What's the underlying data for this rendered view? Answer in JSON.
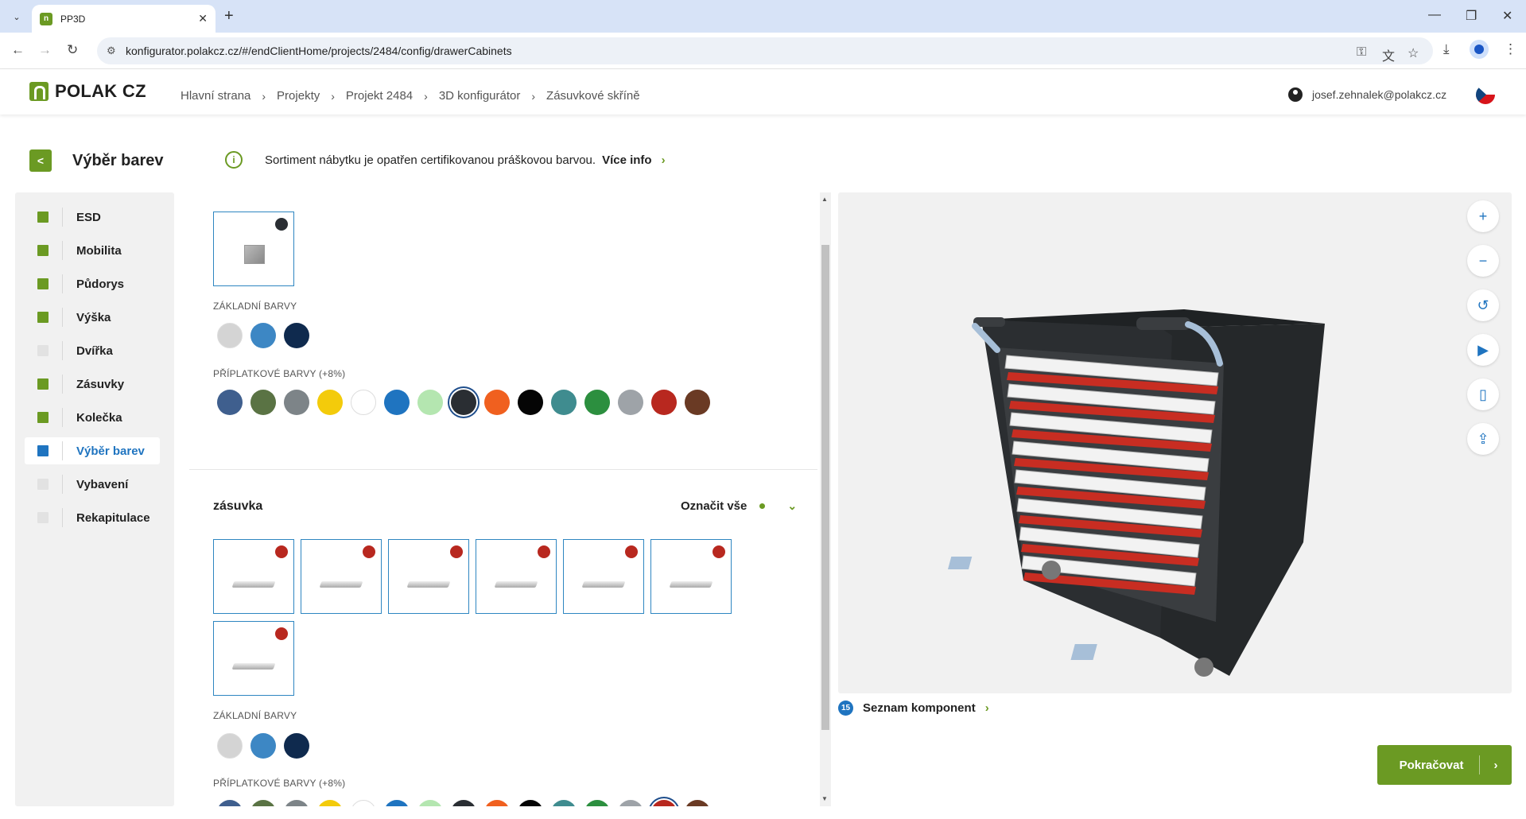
{
  "browser": {
    "tab_title": "PP3D",
    "url": "konfigurator.polakcz.cz/#/endClientHome/projects/2484/config/drawerCabinets"
  },
  "header": {
    "logo_text": "POLAK CZ",
    "breadcrumbs": [
      "Hlavní strana",
      "Projekty",
      "Projekt 2484",
      "3D konfigurátor",
      "Zásuvkové skříně"
    ],
    "user_email": "josef.zehnalek@polakcz.cz"
  },
  "page": {
    "title": "Výběr barev",
    "info_text": "Sortiment nábytku je opatřen certifikovanou práškovou barvou.",
    "info_link": "Více info"
  },
  "sidebar": {
    "items": [
      {
        "label": "ESD",
        "status": "done"
      },
      {
        "label": "Mobilita",
        "status": "done"
      },
      {
        "label": "Půdorys",
        "status": "done"
      },
      {
        "label": "Výška",
        "status": "done"
      },
      {
        "label": "Dvířka",
        "status": "todo"
      },
      {
        "label": "Zásuvky",
        "status": "done"
      },
      {
        "label": "Kolečka",
        "status": "done"
      },
      {
        "label": "Výběr barev",
        "status": "active"
      },
      {
        "label": "Vybavení",
        "status": "todo"
      },
      {
        "label": "Rekapitulace",
        "status": "todo"
      }
    ]
  },
  "colors": {
    "accent": "#6b9a23",
    "active": "#1f74c0",
    "basic": [
      "#d4d4d4",
      "#3d87c4",
      "#0f2a4e"
    ],
    "premium": [
      "#3f5f8e",
      "#5a7344",
      "#7d8488",
      "#f3cb0b",
      "#ffffff",
      "#1f74c0",
      "#b4e6b0",
      "#2a2e33",
      "#f0601f",
      "#050505",
      "#3f8c8f",
      "#2c8f3f",
      "#9ea3a8",
      "#b8281f",
      "#6a3a24"
    ]
  },
  "section1": {
    "basic_label": "ZÁKLADNÍ BARVY",
    "premium_label": "PŘÍPLATKOVÉ BARVY (+8%)",
    "selected_premium_index": 7,
    "dot_color": "#2a2e33"
  },
  "section2": {
    "name": "zásuvka",
    "mark_all": "Označit vše",
    "basic_label": "ZÁKLADNÍ BARVY",
    "premium_label": "PŘÍPLATKOVÉ BARVY (+8%)",
    "selected_premium_index": 13,
    "dot_color": "#b8281f",
    "drawer_count": 7
  },
  "viewer": {
    "buttons": [
      "zoom-in-icon",
      "zoom-out-icon",
      "reset-view-icon",
      "play-icon",
      "split-view-icon",
      "share-icon"
    ],
    "component_count": "15",
    "component_list_label": "Seznam komponent"
  },
  "continue_label": "Pokračovat"
}
